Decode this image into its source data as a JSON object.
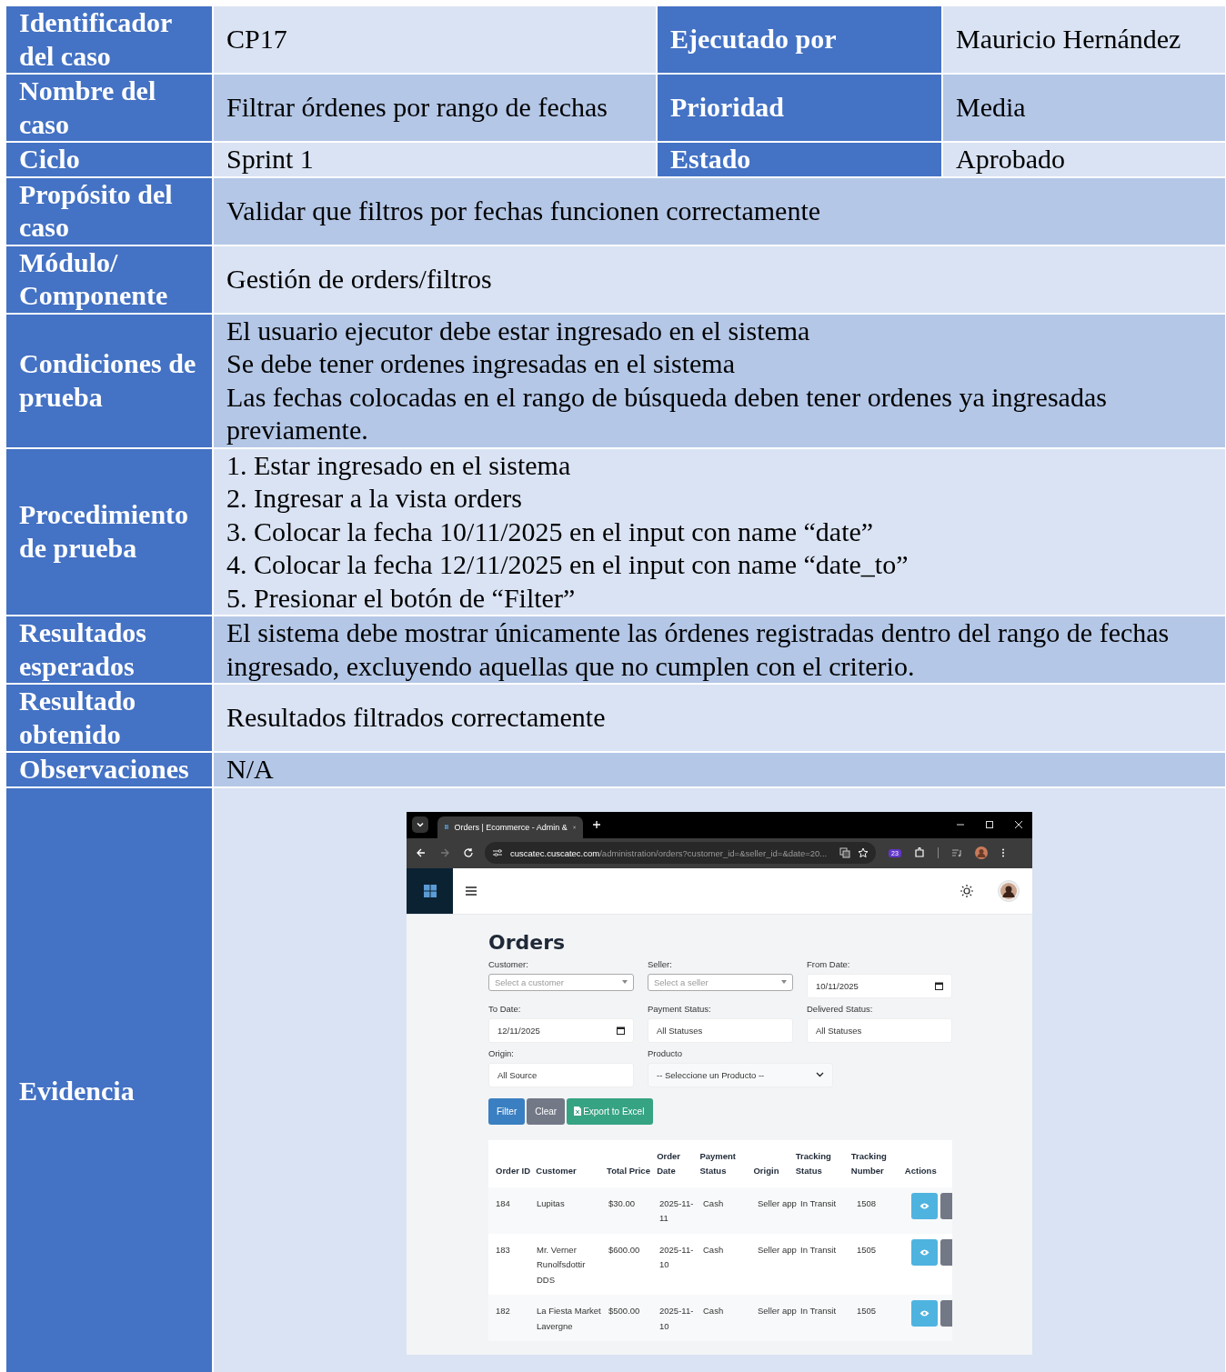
{
  "case_fields": [
    {
      "label": "Identificador del caso",
      "value": "CP17",
      "extra_label": "Ejecutado por",
      "extra_value": "Mauricio Hernández"
    },
    {
      "label": "Nombre del caso",
      "value": "Filtrar órdenes por rango de fechas",
      "extra_label": "Prioridad",
      "extra_value": "Media"
    },
    {
      "label": "Ciclo",
      "value": "Sprint 1",
      "extra_label": "Estado",
      "extra_value": "Aprobado"
    },
    {
      "label": "Propósito del caso",
      "value": "Validar que filtros por fechas funcionen correctamente"
    },
    {
      "label": "Módulo/ Componente",
      "value": "Gestión de orders/filtros"
    },
    {
      "label": "Condiciones de prueba",
      "lines": [
        "El usuario ejecutor debe estar ingresado en el sistema",
        "Se debe tener ordenes ingresadas en el sistema",
        "Las fechas colocadas en el rango de búsqueda deben tener ordenes ya ingresadas previamente."
      ]
    },
    {
      "label": "Procedimiento de prueba",
      "lines": [
        "1. Estar ingresado en el sistema",
        "2. Ingresar a la vista orders",
        "3. Colocar la fecha 10/11/2025 en el input con name “date”",
        "4. Colocar la fecha 12/11/2025 en el input con name “date_to”",
        "5. Presionar el botón de “Filter”"
      ]
    },
    {
      "label": "Resultados esperados",
      "value": "El sistema debe mostrar únicamente las órdenes registradas dentro del rango de fechas ingresado, excluyendo aquellas que no cumplen con el criterio."
    },
    {
      "label": "Resultado obtenido",
      "value": "Resultados filtrados correctamente"
    },
    {
      "label": "Observaciones",
      "value": "N/A"
    }
  ],
  "evidence": {
    "label": "Evidencia",
    "browser": {
      "tab_title": "Orders | Ecommerce - Admin &",
      "url_host": "cuscatec.cuscatec.com",
      "url_path": "/administration/orders?customer_id=&seller_id=&date=20...",
      "extension_badge": "23"
    },
    "page": {
      "heading": "Orders",
      "filters": [
        {
          "label": "Customer:",
          "kind": "select2",
          "placeholder": "Select a customer"
        },
        {
          "label": "Seller:",
          "kind": "select2",
          "placeholder": "Select a seller"
        },
        {
          "label": "From Date:",
          "kind": "date",
          "value": "10/11/2025"
        },
        {
          "label": "To Date:",
          "kind": "date",
          "value": "12/11/2025"
        },
        {
          "label": "Payment Status:",
          "kind": "text",
          "value": "All Statuses"
        },
        {
          "label": "Delivered Status:",
          "kind": "text",
          "value": "All Statuses"
        },
        {
          "label": "Origin:",
          "kind": "text",
          "value": "All Source"
        },
        {
          "label": "Producto",
          "kind": "dropdown",
          "value": "-- Seleccione un Producto --"
        }
      ],
      "buttons": [
        {
          "label": "Filter",
          "kind": "primary"
        },
        {
          "label": "Clear",
          "kind": "secondary"
        },
        {
          "label": "Export to Excel",
          "kind": "success"
        }
      ],
      "table": {
        "columns": [
          "Order ID",
          "Customer",
          "Total Price",
          "Order Date",
          "Payment Status",
          "Origin",
          "Tracking Status",
          "Tracking Number",
          "Actions"
        ],
        "rows": [
          {
            "cells": [
              "184",
              "Lupitas",
              "$30.00",
              "2025-11-11",
              "Cash",
              "Seller app",
              "In Transit",
              "1508"
            ]
          },
          {
            "cells": [
              "183",
              "Mr. Verner Runolfsdottir DDS",
              "$600.00",
              "2025-11-10",
              "Cash",
              "Seller app",
              "In Transit",
              "1505"
            ]
          },
          {
            "cells": [
              "182",
              "La Fiesta Market Lavergne",
              "$500.00",
              "2025-11-10",
              "Cash",
              "Seller app",
              "In Transit",
              "1505"
            ]
          }
        ]
      }
    }
  }
}
